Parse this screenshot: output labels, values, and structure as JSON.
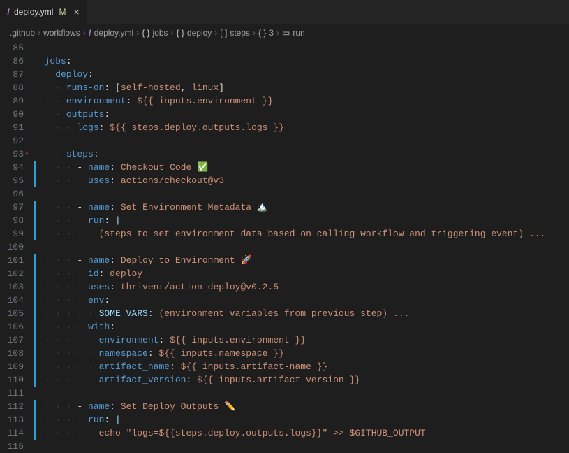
{
  "tab": {
    "icon": "!",
    "name": "deploy.yml",
    "modified": "M",
    "close": "×"
  },
  "breadcrumbs": [
    {
      "type": "folder",
      "text": ".github"
    },
    {
      "type": "folder",
      "text": "workflows"
    },
    {
      "type": "file",
      "icon": "!",
      "text": "deploy.yml"
    },
    {
      "type": "brace",
      "text": "jobs"
    },
    {
      "type": "brace",
      "text": "deploy"
    },
    {
      "type": "bracket",
      "text": "steps"
    },
    {
      "type": "brace",
      "text": "3"
    },
    {
      "type": "run",
      "text": "run"
    }
  ],
  "code": {
    "first_line": 85,
    "lines": [
      {
        "n": 85,
        "mod": false,
        "fold": false,
        "spans": [
          [
            "indent",
            "  "
          ]
        ]
      },
      {
        "n": 86,
        "mod": false,
        "fold": false,
        "spans": [
          [
            "indent",
            "  "
          ],
          [
            "key",
            "jobs"
          ],
          [
            "punc",
            ":"
          ]
        ]
      },
      {
        "n": 87,
        "mod": false,
        "fold": false,
        "spans": [
          [
            "indent",
            "  · "
          ],
          [
            "key",
            "deploy"
          ],
          [
            "punc",
            ":"
          ]
        ]
      },
      {
        "n": 88,
        "mod": false,
        "fold": false,
        "spans": [
          [
            "indent",
            "  · · "
          ],
          [
            "key",
            "runs-on"
          ],
          [
            "punc",
            ": ["
          ],
          [
            "str",
            "self-hosted"
          ],
          [
            "punc",
            ", "
          ],
          [
            "str",
            "linux"
          ],
          [
            "punc",
            "]"
          ]
        ]
      },
      {
        "n": 89,
        "mod": false,
        "fold": false,
        "spans": [
          [
            "indent",
            "  · · "
          ],
          [
            "key",
            "environment"
          ],
          [
            "punc",
            ": "
          ],
          [
            "str",
            "${{ inputs.environment }}"
          ]
        ]
      },
      {
        "n": 90,
        "mod": false,
        "fold": false,
        "spans": [
          [
            "indent",
            "  · · "
          ],
          [
            "key",
            "outputs"
          ],
          [
            "punc",
            ":"
          ]
        ]
      },
      {
        "n": 91,
        "mod": false,
        "fold": false,
        "spans": [
          [
            "indent",
            "  · · · "
          ],
          [
            "key",
            "logs"
          ],
          [
            "punc",
            ": "
          ],
          [
            "str",
            "${{ steps.deploy.outputs.logs }}"
          ]
        ]
      },
      {
        "n": 92,
        "mod": false,
        "fold": false,
        "spans": [
          [
            "indent",
            ""
          ]
        ]
      },
      {
        "n": 93,
        "mod": false,
        "fold": true,
        "spans": [
          [
            "indent",
            "  · · "
          ],
          [
            "key",
            "steps"
          ],
          [
            "punc",
            ":"
          ]
        ]
      },
      {
        "n": 94,
        "mod": true,
        "fold": false,
        "spans": [
          [
            "indent",
            "  · · · "
          ],
          [
            "punc",
            "- "
          ],
          [
            "key",
            "name"
          ],
          [
            "punc",
            ": "
          ],
          [
            "str",
            "Checkout Code ✅"
          ]
        ]
      },
      {
        "n": 95,
        "mod": true,
        "fold": false,
        "spans": [
          [
            "indent",
            "  · · · · "
          ],
          [
            "key",
            "uses"
          ],
          [
            "punc",
            ": "
          ],
          [
            "str",
            "actions/checkout@v3"
          ]
        ]
      },
      {
        "n": 96,
        "mod": false,
        "fold": false,
        "spans": [
          [
            "indent",
            ""
          ]
        ]
      },
      {
        "n": 97,
        "mod": true,
        "fold": false,
        "spans": [
          [
            "indent",
            "  · · · "
          ],
          [
            "punc",
            "- "
          ],
          [
            "key",
            "name"
          ],
          [
            "punc",
            ": "
          ],
          [
            "str",
            "Set Environment Metadata "
          ],
          [
            "str",
            "🏔️"
          ]
        ]
      },
      {
        "n": 98,
        "mod": true,
        "fold": false,
        "spans": [
          [
            "indent",
            "  · · · · "
          ],
          [
            "key",
            "run"
          ],
          [
            "punc",
            ": "
          ],
          [
            "var",
            "|"
          ]
        ]
      },
      {
        "n": 99,
        "mod": true,
        "fold": false,
        "spans": [
          [
            "indent",
            "  · · · · · "
          ],
          [
            "str",
            "(steps to set environment data based on calling workflow and triggering event) ..."
          ]
        ]
      },
      {
        "n": 100,
        "mod": false,
        "fold": false,
        "spans": [
          [
            "indent",
            ""
          ]
        ]
      },
      {
        "n": 101,
        "mod": true,
        "fold": false,
        "spans": [
          [
            "indent",
            "  · · · "
          ],
          [
            "punc",
            "- "
          ],
          [
            "key",
            "name"
          ],
          [
            "punc",
            ": "
          ],
          [
            "str",
            "Deploy to Environment 🚀"
          ]
        ]
      },
      {
        "n": 102,
        "mod": true,
        "fold": false,
        "spans": [
          [
            "indent",
            "  · · · · "
          ],
          [
            "key",
            "id"
          ],
          [
            "punc",
            ": "
          ],
          [
            "str",
            "deploy"
          ]
        ]
      },
      {
        "n": 103,
        "mod": true,
        "fold": false,
        "spans": [
          [
            "indent",
            "  · · · · "
          ],
          [
            "key",
            "uses"
          ],
          [
            "punc",
            ": "
          ],
          [
            "str",
            "thrivent/action-deploy@v0.2.5"
          ]
        ]
      },
      {
        "n": 104,
        "mod": true,
        "fold": false,
        "spans": [
          [
            "indent",
            "  · · · · "
          ],
          [
            "key",
            "env"
          ],
          [
            "punc",
            ":"
          ]
        ]
      },
      {
        "n": 105,
        "mod": true,
        "fold": false,
        "spans": [
          [
            "indent",
            "  · · · · · "
          ],
          [
            "var",
            "SOME_VARS"
          ],
          [
            "punc",
            ": "
          ],
          [
            "str",
            "(environment variables from previous step) ..."
          ]
        ]
      },
      {
        "n": 106,
        "mod": true,
        "fold": false,
        "spans": [
          [
            "indent",
            "  · · · · "
          ],
          [
            "key",
            "with"
          ],
          [
            "punc",
            ":"
          ]
        ]
      },
      {
        "n": 107,
        "mod": true,
        "fold": false,
        "spans": [
          [
            "indent",
            "  · · · · · "
          ],
          [
            "key",
            "environment"
          ],
          [
            "punc",
            ": "
          ],
          [
            "str",
            "${{ inputs.environment }}"
          ]
        ]
      },
      {
        "n": 108,
        "mod": true,
        "fold": false,
        "spans": [
          [
            "indent",
            "  · · · · · "
          ],
          [
            "key",
            "namespace"
          ],
          [
            "punc",
            ": "
          ],
          [
            "str",
            "${{ inputs.namespace }}"
          ]
        ]
      },
      {
        "n": 109,
        "mod": true,
        "fold": false,
        "spans": [
          [
            "indent",
            "  · · · · · "
          ],
          [
            "key",
            "artifact_name"
          ],
          [
            "punc",
            ": "
          ],
          [
            "str",
            "${{ inputs.artifact-name }}"
          ]
        ]
      },
      {
        "n": 110,
        "mod": true,
        "fold": false,
        "spans": [
          [
            "indent",
            "  · · · · · "
          ],
          [
            "key",
            "artifact_version"
          ],
          [
            "punc",
            ": "
          ],
          [
            "str",
            "${{ inputs.artifact-version }}"
          ]
        ]
      },
      {
        "n": 111,
        "mod": false,
        "fold": false,
        "spans": [
          [
            "indent",
            ""
          ]
        ]
      },
      {
        "n": 112,
        "mod": true,
        "fold": false,
        "spans": [
          [
            "indent",
            "  · · · "
          ],
          [
            "punc",
            "- "
          ],
          [
            "key",
            "name"
          ],
          [
            "punc",
            ": "
          ],
          [
            "str",
            "Set Deploy Outputs ✏️"
          ]
        ]
      },
      {
        "n": 113,
        "mod": true,
        "fold": false,
        "spans": [
          [
            "indent",
            "  · · · · "
          ],
          [
            "key",
            "run"
          ],
          [
            "punc",
            ": "
          ],
          [
            "var",
            "|"
          ]
        ]
      },
      {
        "n": 114,
        "mod": true,
        "fold": false,
        "spans": [
          [
            "indent",
            "  · · · · · "
          ],
          [
            "str",
            "echo \"logs=${{steps.deploy.outputs.logs}}\" >> $GITHUB_OUTPUT"
          ]
        ]
      },
      {
        "n": 115,
        "mod": false,
        "fold": false,
        "spans": [
          [
            "indent",
            "  "
          ]
        ]
      }
    ]
  }
}
